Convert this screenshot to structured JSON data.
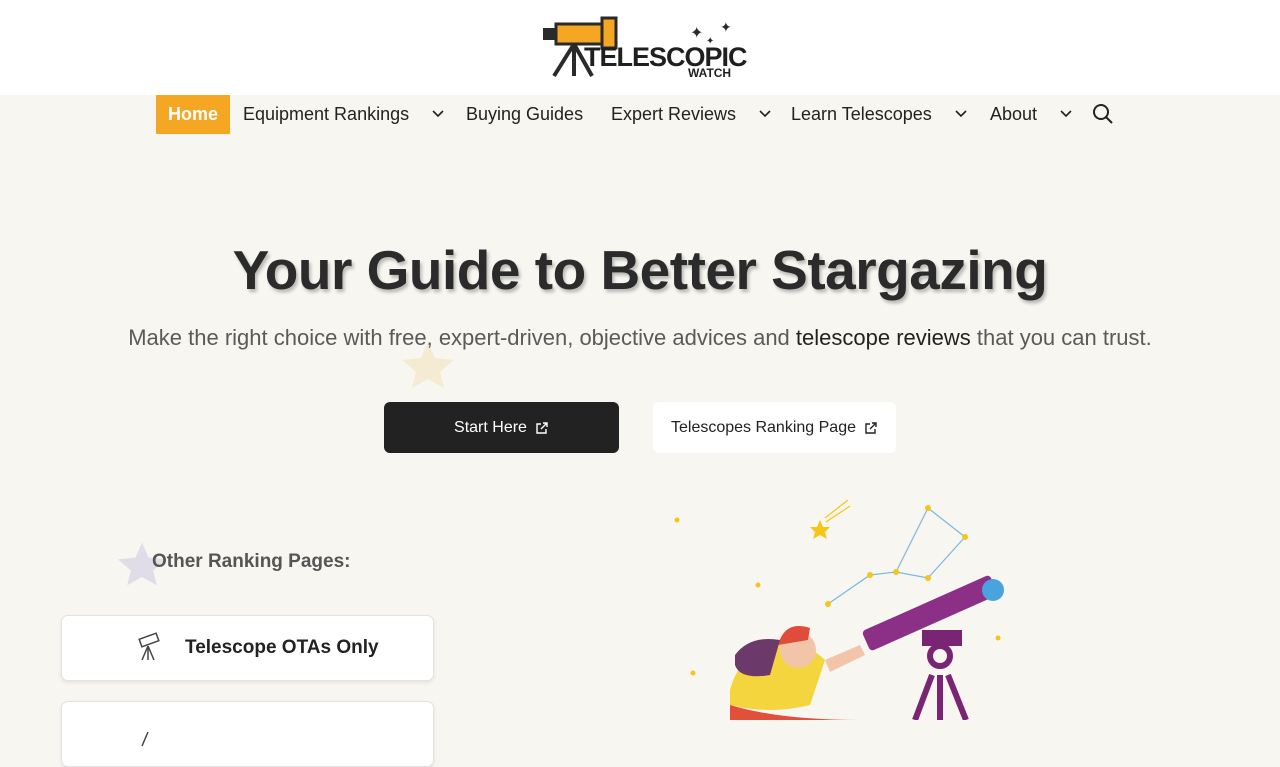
{
  "brand": {
    "logo_main": "TELESCOPIC",
    "logo_sub": "WATCH",
    "accent_color": "#f5a623"
  },
  "nav": {
    "items": [
      {
        "label": "Home",
        "active": true
      },
      {
        "label": "Equipment Rankings",
        "has_dropdown": true
      },
      {
        "label": "Buying Guides"
      },
      {
        "label": "Expert Reviews",
        "has_dropdown": true
      },
      {
        "label": "Learn Telescopes",
        "has_dropdown": true
      },
      {
        "label": "About",
        "has_dropdown": true
      }
    ],
    "search_icon": "search-icon"
  },
  "hero": {
    "title": "Your Guide to Better Stargazing",
    "subtitle_pre": "Make the right choice with free, expert-driven, objective advices and ",
    "subtitle_highlight": "telescope reviews",
    "subtitle_post": " that you can trust.",
    "primary_button": "Start Here",
    "secondary_button": "Telescopes Ranking Page"
  },
  "other_rankings": {
    "heading": "Other Ranking Pages:",
    "cards": [
      {
        "label": "Telescope OTAs Only",
        "icon": "telescope-icon"
      },
      {
        "label": "",
        "icon": "telescope-icon"
      }
    ]
  }
}
